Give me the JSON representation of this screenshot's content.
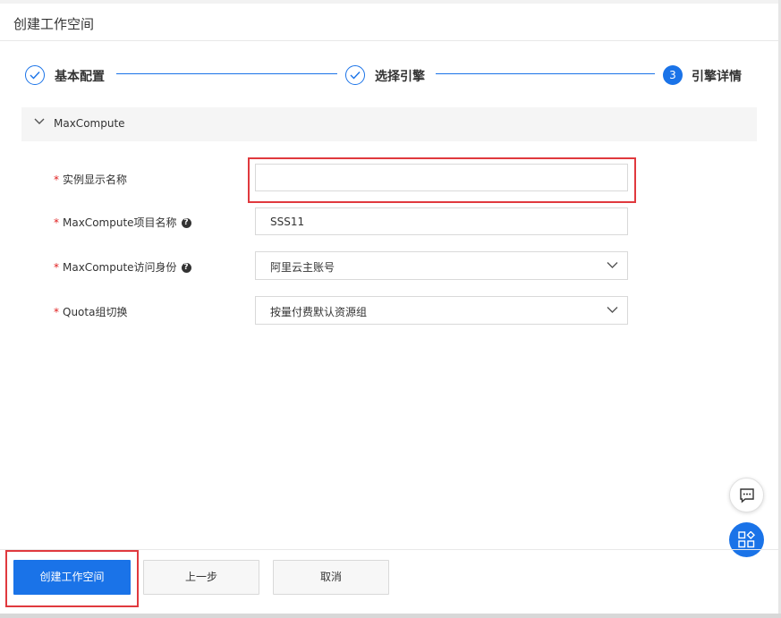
{
  "header": {
    "title": "创建工作空间"
  },
  "steps": [
    {
      "number": "1",
      "label": "基本配置",
      "status": "done"
    },
    {
      "number": "2",
      "label": "选择引擎",
      "status": "done"
    },
    {
      "number": "3",
      "label": "引擎详情",
      "status": "current"
    }
  ],
  "section": {
    "title": "MaxCompute",
    "expanded": true
  },
  "form": {
    "required_mark": "*",
    "instance_name": {
      "label": "实例显示名称",
      "value": "",
      "placeholder": ""
    },
    "project_name": {
      "label": "MaxCompute项目名称",
      "value": "SSS11",
      "help_icon": "question-circle-icon"
    },
    "access_identity": {
      "label": "MaxCompute访问身份",
      "value": "阿里云主账号",
      "help_icon": "question-circle-icon"
    },
    "quota_group": {
      "label": "Quota组切换",
      "value": "按量付费默认资源组"
    }
  },
  "footer": {
    "create_label": "创建工作空间",
    "prev_label": "上一步",
    "cancel_label": "取消"
  },
  "floating": {
    "chat_icon": "chat-icon",
    "apps_icon": "apps-grid-icon"
  },
  "colors": {
    "accent": "#1a73e8",
    "highlight": "#e0393e",
    "required": "#e02020"
  }
}
